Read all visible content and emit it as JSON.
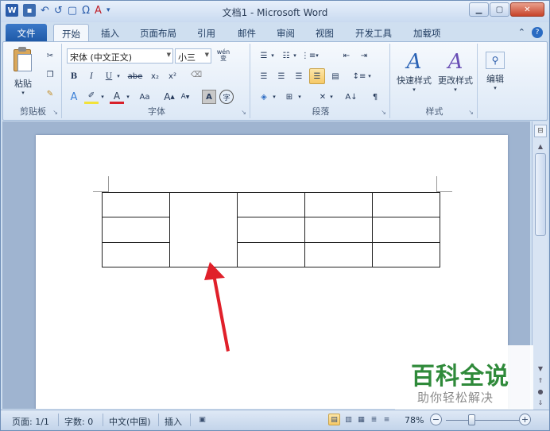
{
  "window": {
    "title": "文档1 - Microsoft Word"
  },
  "qat": {
    "word_icon": "W",
    "save_icon": "save-icon",
    "undo": "↶",
    "redo": "↺",
    "new": "▢",
    "symbol": "Ω",
    "fontcolor": "A"
  },
  "tabs": [
    "文件",
    "开始",
    "插入",
    "页面布局",
    "引用",
    "邮件",
    "审阅",
    "视图",
    "开发工具",
    "加载项"
  ],
  "ribbon": {
    "clipboard": {
      "paste": "粘贴",
      "label": "剪贴板"
    },
    "font": {
      "name": "宋体 (中文正文)",
      "size": "小三",
      "wen": "wén",
      "wen_char": "变",
      "label": "字体",
      "bold": "B",
      "italic": "I",
      "underline": "U",
      "strike": "abe",
      "sub": "x₂",
      "sup": "x²",
      "aa": "Aa",
      "grow": "A",
      "shrink": "A",
      "char_border": "A",
      "enclose": "字"
    },
    "paragraph": {
      "label": "段落"
    },
    "styles": {
      "quick": "快速样式",
      "change": "更改样式",
      "label": "样式"
    },
    "editing": {
      "label": "编辑"
    }
  },
  "statusbar": {
    "page": "页面: 1/1",
    "words": "字数: 0",
    "lang": "中文(中国)",
    "mode": "插入",
    "zoom": "78%"
  },
  "zoom_percent": 78,
  "watermark": {
    "big": "百科全说",
    "small": "助你轻松解决"
  },
  "colors": {
    "accent": "#2a5caa",
    "arrow": "#e0202a",
    "watermark_green": "#2f8a3a"
  }
}
